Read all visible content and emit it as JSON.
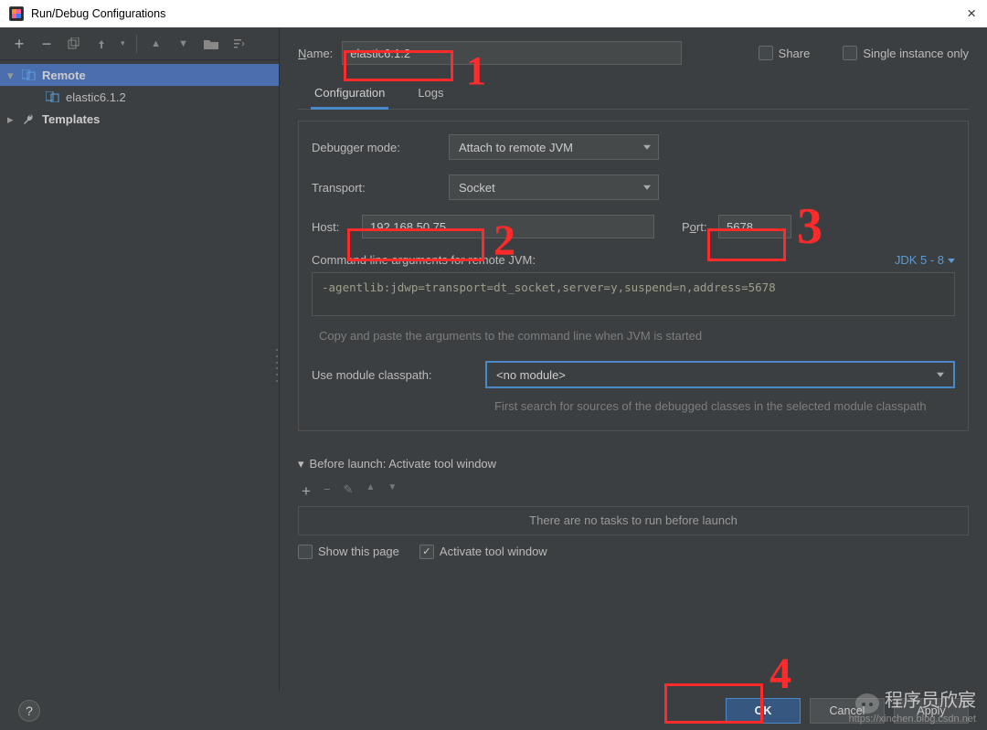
{
  "title": "Run/Debug Configurations",
  "toolbar": {
    "add": "+",
    "remove": "−"
  },
  "sidebar": {
    "remote_group": "Remote",
    "remote_child": "elastic6.1.2",
    "templates": "Templates"
  },
  "name_label": "Name:",
  "name_value": "elastic6.1.2",
  "share_label": "Share",
  "single_instance_label": "Single instance only",
  "tabs": {
    "configuration": "Configuration",
    "logs": "Logs"
  },
  "form": {
    "debugger_mode_label": "Debugger mode:",
    "debugger_mode_value": "Attach to remote JVM",
    "transport_label": "Transport:",
    "transport_value": "Socket",
    "host_label": "Host:",
    "host_value": "192.168.50.75",
    "port_label": "Port:",
    "port_value": "5678",
    "cmd_label": "Command line arguments for remote JVM:",
    "jdk_label": "JDK 5 - 8",
    "cmd_value": "-agentlib:jdwp=transport=dt_socket,server=y,suspend=n,address=5678",
    "cmd_hint": "Copy and paste the arguments to the command line when JVM is started",
    "module_label": "Use module classpath:",
    "module_value": "<no module>",
    "module_hint": "First search for sources of the debugged classes in the selected module classpath"
  },
  "before_launch": {
    "header": "Before launch: Activate tool window",
    "empty": "There are no tasks to run before launch",
    "show_this_page": "Show this page",
    "activate_tool_window": "Activate tool window"
  },
  "footer": {
    "ok": "OK",
    "cancel": "Cancel",
    "apply": "Apply"
  },
  "annotations": {
    "n1": "1",
    "n2": "2",
    "n3": "3",
    "n4": "4"
  },
  "watermark": {
    "name": "程序员欣宸",
    "url": "https://xinchen.blog.csdn.net"
  }
}
